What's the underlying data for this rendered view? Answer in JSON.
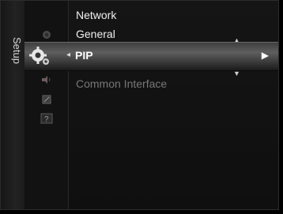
{
  "menu": {
    "title": "Setup"
  },
  "items": {
    "network": "Network",
    "general": "General",
    "pip": "PIP",
    "common_interface": "Common Interface"
  },
  "icons": [
    "picture-icon",
    "setup-gear-icon",
    "sound-icon",
    "input-icon",
    "support-icon"
  ],
  "colors": {
    "selection": "#555555",
    "text": "#f1f1f1",
    "disabled": "#777777"
  }
}
